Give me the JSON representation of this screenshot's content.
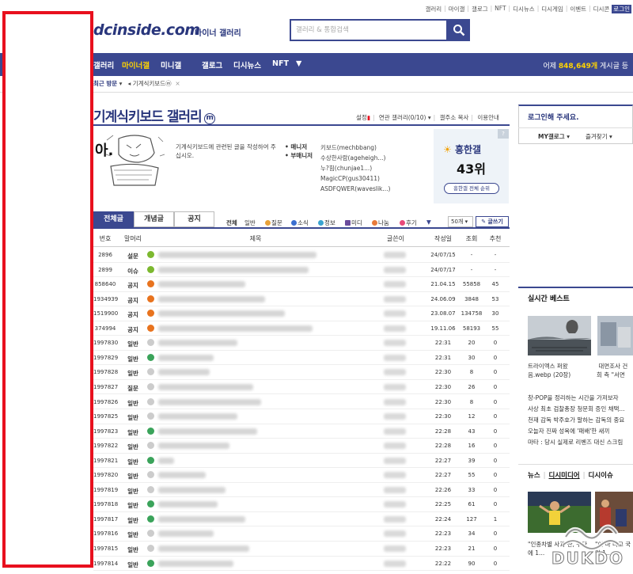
{
  "top_links": [
    "갤러리",
    "마이갤",
    "갤로그",
    "NFT",
    "디시뉴스",
    "디시게임",
    "이벤트",
    "디시콘",
    "로그인"
  ],
  "logo": {
    "text": "dcinside.com",
    "sub": "마이너 갤러리"
  },
  "search": {
    "placeholder": "갤러리 & 통합검색"
  },
  "nav": {
    "items": [
      "갤러리",
      "마이너갤",
      "미니갤",
      "갤로그",
      "디시뉴스",
      "NFT",
      "▼"
    ],
    "right_prefix": "어제 ",
    "right_count": "848,649개",
    "right_suffix": " 게시글 등"
  },
  "recent": {
    "label": "최근 방문",
    "item": "기계식키보드ⓜ",
    "close": "×"
  },
  "gallery": {
    "title": "기계식키보드 갤러리",
    "badge": "m",
    "links": [
      "설정",
      "연관 갤러리(0/10)",
      "갤주소 복사",
      "이용안내"
    ]
  },
  "info": {
    "ima": "아.",
    "desc": "기계식키보드에 관련된 글을 작성하여 주십시오.",
    "manager_label": "• 매니저",
    "submanager_label": "• 부매니저",
    "manager": "키보드(mechbbang)",
    "submanagers": [
      "수상한사람(ageheigh...)",
      "누?힘(chunjae1...)",
      "MagicCP(gus30411)",
      "ASDFQWER(waveslik...)"
    ],
    "rank_name": "흥한갤",
    "rank_num": "43위",
    "rank_btn": "흥한갤 전체 순위",
    "corner": "?"
  },
  "tabs": [
    "전체글",
    "개념글",
    "공지"
  ],
  "categories": [
    "전체",
    "일반",
    "질문",
    "소식",
    "정보",
    "미디",
    "나눔",
    "후기",
    "▼"
  ],
  "list_count": "50개 ▾",
  "write_btn": "✎ 글쓰기",
  "table": {
    "headers": [
      "번호",
      "말머리",
      "제목",
      "글쓴이",
      "작성일",
      "조회",
      "추천"
    ],
    "rows": [
      {
        "no": "2896",
        "head": "설문",
        "date": "24/07/15",
        "views": "-",
        "rec": "-",
        "ico": "#7cb82f",
        "w": 200
      },
      {
        "no": "2899",
        "head": "이슈",
        "date": "24/07/17",
        "views": "-",
        "rec": "-",
        "ico": "#7cb82f",
        "w": 190
      },
      {
        "no": "858640",
        "head": "공지",
        "date": "21.04.15",
        "views": "55858",
        "rec": "45",
        "ico": "#e8731e",
        "w": 110
      },
      {
        "no": "1934939",
        "head": "공지",
        "date": "24.06.09",
        "views": "3848",
        "rec": "53",
        "ico": "#e8731e",
        "w": 135
      },
      {
        "no": "1519900",
        "head": "공지",
        "date": "23.08.07",
        "views": "134758",
        "rec": "30",
        "ico": "#e8731e",
        "w": 160
      },
      {
        "no": "374994",
        "head": "공지",
        "date": "19.11.06",
        "views": "58193",
        "rec": "55",
        "ico": "#e8731e",
        "w": 195
      },
      {
        "no": "1997830",
        "head": "일반",
        "date": "22:31",
        "views": "20",
        "rec": "0",
        "ico": "#cccccc",
        "w": 100
      },
      {
        "no": "1997829",
        "head": "일반",
        "date": "22:31",
        "views": "30",
        "rec": "0",
        "ico": "#3aa35a",
        "w": 70
      },
      {
        "no": "1997828",
        "head": "일반",
        "date": "22:30",
        "views": "8",
        "rec": "0",
        "ico": "#cccccc",
        "w": 65
      },
      {
        "no": "1997827",
        "head": "질문",
        "date": "22:30",
        "views": "26",
        "rec": "0",
        "ico": "#cccccc",
        "w": 120
      },
      {
        "no": "1997826",
        "head": "일반",
        "date": "22:30",
        "views": "8",
        "rec": "0",
        "ico": "#cccccc",
        "w": 130
      },
      {
        "no": "1997825",
        "head": "일반",
        "date": "22:30",
        "views": "12",
        "rec": "0",
        "ico": "#cccccc",
        "w": 100
      },
      {
        "no": "1997823",
        "head": "일반",
        "date": "22:28",
        "views": "43",
        "rec": "0",
        "ico": "#3aa35a",
        "w": 125
      },
      {
        "no": "1997822",
        "head": "일반",
        "date": "22:28",
        "views": "16",
        "rec": "0",
        "ico": "#cccccc",
        "w": 90
      },
      {
        "no": "1997821",
        "head": "일반",
        "date": "22:27",
        "views": "39",
        "rec": "0",
        "ico": "#3aa35a",
        "w": 20
      },
      {
        "no": "1997820",
        "head": "일반",
        "date": "22:27",
        "views": "55",
        "rec": "0",
        "ico": "#cccccc",
        "w": 60
      },
      {
        "no": "1997819",
        "head": "일반",
        "date": "22:26",
        "views": "33",
        "rec": "0",
        "ico": "#cccccc",
        "w": 85
      },
      {
        "no": "1997818",
        "head": "일반",
        "date": "22:25",
        "views": "61",
        "rec": "0",
        "ico": "#3aa35a",
        "w": 75
      },
      {
        "no": "1997817",
        "head": "일반",
        "date": "22:24",
        "views": "127",
        "rec": "1",
        "ico": "#3aa35a",
        "w": 110
      },
      {
        "no": "1997816",
        "head": "일반",
        "date": "22:23",
        "views": "34",
        "rec": "0",
        "ico": "#cccccc",
        "w": 70
      },
      {
        "no": "1997815",
        "head": "일반",
        "date": "22:23",
        "views": "21",
        "rec": "0",
        "ico": "#cccccc",
        "w": 115
      },
      {
        "no": "1997814",
        "head": "일반",
        "date": "22:22",
        "views": "90",
        "rec": "0",
        "ico": "#3aa35a",
        "w": 95
      }
    ]
  },
  "login": {
    "title": "로그인해 주세요.",
    "link1": "MY갤로그",
    "link2": "즐겨찾기"
  },
  "best": {
    "title": "실시간 베스트",
    "cap1": "트라이엑스 퍼왔 음.webp (20장)",
    "cap2": "᠎ 대면조사 건희 측 \"서면",
    "list": [
      "창-POP을 정리하는 시간을 가져보자",
      "사상 최초 검찰총장 청문회 증인 채택...",
      "천재 감독 박주호가 말하는 감독의 중요",
      "오늘자 진짜 성욕에 '패배'한 새끼",
      "마타 : 당시 실제로 리벤즈 대신 스크림"
    ]
  },
  "news": {
    "tabs": [
      "뉴스",
      "디시미디어",
      "디시이슈"
    ],
    "cap1": "\"인종차별 사과 찬, 구단에 1...",
    "cap2": "\"이 마 다고 국민 1..."
  },
  "watermark": "DUKDO",
  "colors": {
    "brand": "#3b4890",
    "accent": "#ffd400",
    "red_box": "#e8101e"
  }
}
